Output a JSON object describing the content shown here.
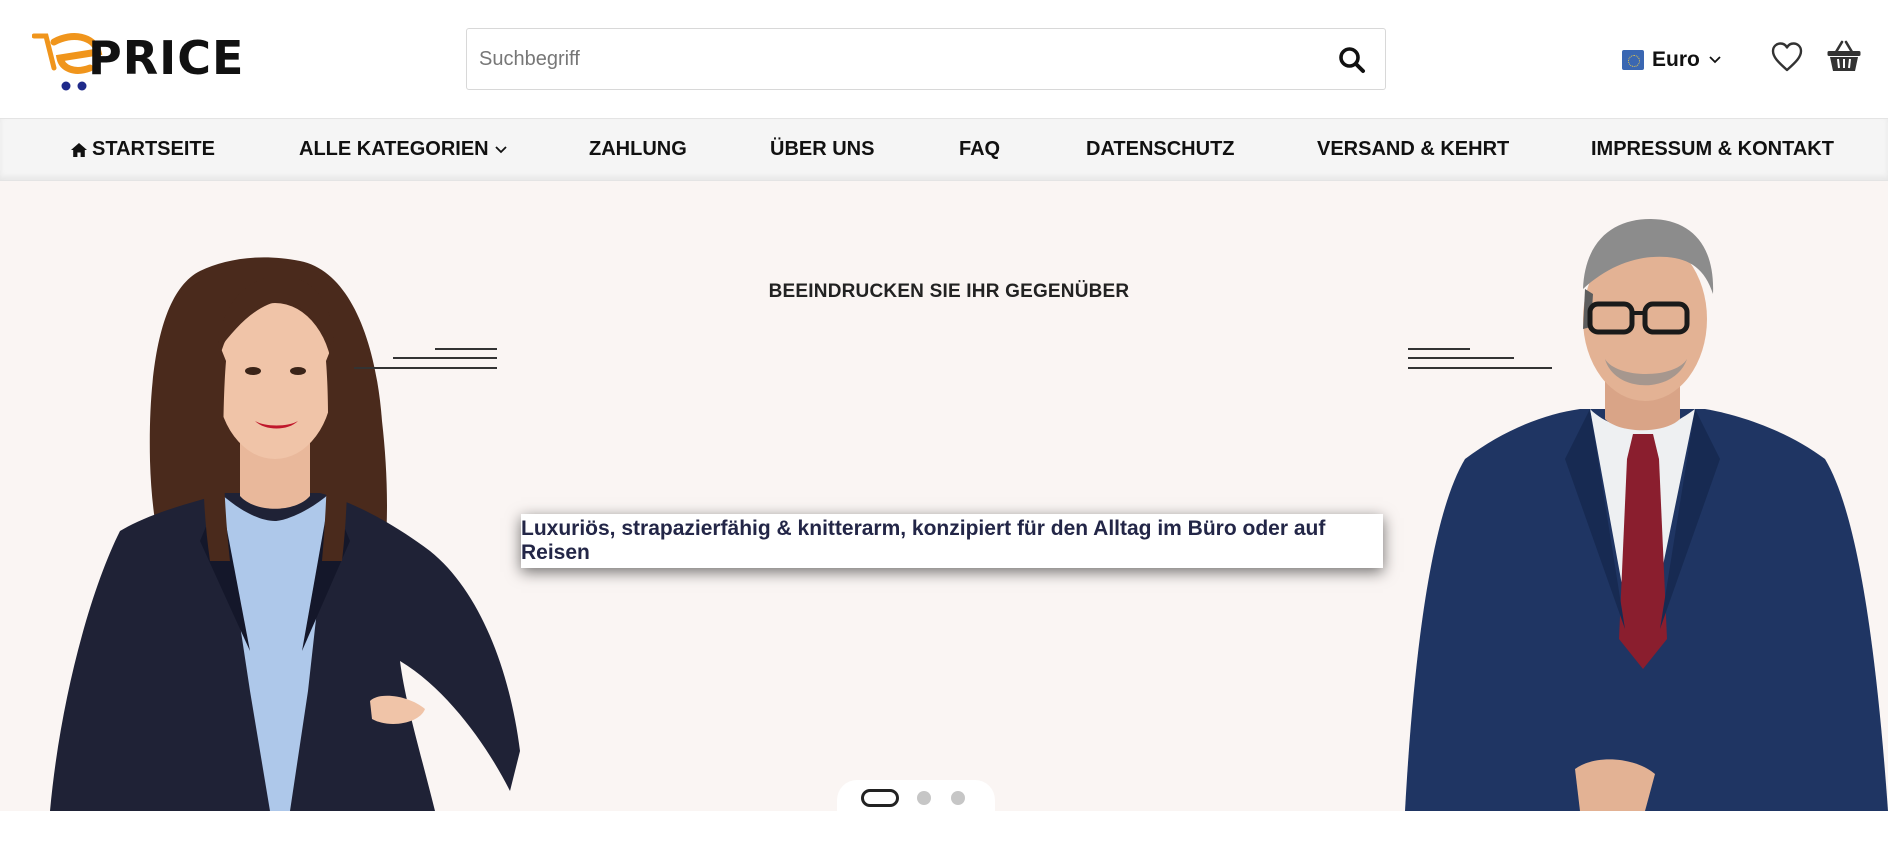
{
  "header": {
    "logo_text": "PRICE",
    "search_placeholder": "Suchbegriff",
    "currency": "Euro",
    "icons": [
      "search-icon",
      "euro-flag-icon",
      "chevron-down-icon",
      "heart-icon",
      "basket-icon"
    ]
  },
  "nav": {
    "items": [
      {
        "label": "STARTSEITE",
        "icon": "home-icon"
      },
      {
        "label": "ALLE KATEGORIEN",
        "icon": "chevron-down-icon"
      },
      {
        "label": "ZAHLUNG"
      },
      {
        "label": "ÜBER UNS"
      },
      {
        "label": "FAQ"
      },
      {
        "label": "DATENSCHUTZ"
      },
      {
        "label": "VERSAND & KEHRT"
      },
      {
        "label": "IMPRESSUM & KONTAKT"
      }
    ]
  },
  "hero": {
    "subtitle": "BEEINDRUCKEN SIE IHR GEGENÜBER",
    "caption": "Luxuriös, strapazierfähig & knitterarm, konzipiert für den Alltag im Büro oder auf Reisen",
    "active_slide": 1,
    "slide_count": 3
  },
  "colors": {
    "logo_orange": "#f0951c",
    "logo_blue": "#1f2a8a",
    "hero_bg": "#faf5f3",
    "caption_text": "#232647",
    "nav_bg": "#f5f5f5"
  }
}
